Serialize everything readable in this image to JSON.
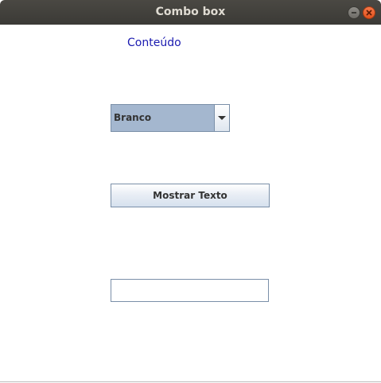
{
  "window": {
    "title": "Combo box"
  },
  "content": {
    "label": "Conteúdo",
    "combo": {
      "selected": "Branco"
    },
    "button": {
      "label": "Mostrar Texto"
    },
    "textfield": {
      "value": ""
    }
  },
  "colors": {
    "label": "#1a1ab0",
    "combo_bg": "#a4b7cf",
    "titlebar": "#3f3e3a",
    "close": "#e95420"
  }
}
